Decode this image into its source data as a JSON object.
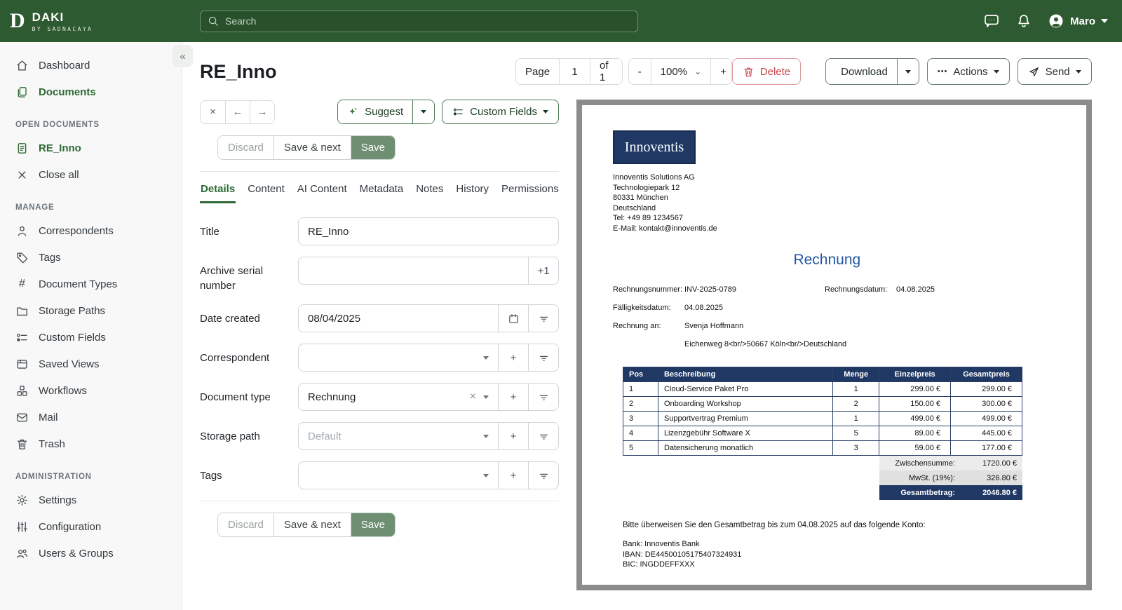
{
  "header": {
    "logo_initial": "D",
    "brand": "DAKI",
    "brand_sub": "BY SADNACAYA",
    "search_placeholder": "Search",
    "user_name": "Maro"
  },
  "sidebar": {
    "nav": [
      {
        "label": "Dashboard"
      },
      {
        "label": "Documents"
      }
    ],
    "sections": [
      {
        "title": "OPEN DOCUMENTS",
        "items": [
          {
            "label": "RE_Inno"
          },
          {
            "label": "Close all"
          }
        ]
      },
      {
        "title": "MANAGE",
        "items": [
          {
            "label": "Correspondents"
          },
          {
            "label": "Tags"
          },
          {
            "label": "Document Types"
          },
          {
            "label": "Storage Paths"
          },
          {
            "label": "Custom Fields"
          },
          {
            "label": "Saved Views"
          },
          {
            "label": "Workflows"
          },
          {
            "label": "Mail"
          },
          {
            "label": "Trash"
          }
        ]
      },
      {
        "title": "ADMINISTRATION",
        "items": [
          {
            "label": "Settings"
          },
          {
            "label": "Configuration"
          },
          {
            "label": "Users & Groups"
          }
        ]
      }
    ]
  },
  "toolbar": {
    "document_title": "RE_Inno",
    "page_label": "Page",
    "page_value": "1",
    "page_of": "of 1",
    "zoom_out": "-",
    "zoom_value": "100%",
    "zoom_in": "+",
    "delete": "Delete",
    "download": "Download",
    "actions": "Actions",
    "actions_dots": "•••",
    "send": "Send"
  },
  "editor": {
    "close": "×",
    "prev": "←",
    "next": "→",
    "collapse": "«",
    "suggest": "Suggest",
    "custom_fields": "Custom Fields",
    "discard": "Discard",
    "save_next": "Save & next",
    "save": "Save",
    "tabs": [
      "Details",
      "Content",
      "AI Content",
      "Metadata",
      "Notes",
      "History",
      "Permissions"
    ],
    "fields": {
      "title": {
        "label": "Title",
        "value": "RE_Inno"
      },
      "asn": {
        "label": "Archive serial number",
        "value": "",
        "increment": "+1"
      },
      "date_created": {
        "label": "Date created",
        "value": "08/04/2025"
      },
      "correspondent": {
        "label": "Correspondent",
        "value": ""
      },
      "document_type": {
        "label": "Document type",
        "value": "Rechnung",
        "clear": "×"
      },
      "storage_path": {
        "label": "Storage path",
        "placeholder": "Default"
      },
      "tags": {
        "label": "Tags",
        "value": ""
      }
    }
  },
  "invoice": {
    "logo_text": "Innoventis",
    "sender_lines": [
      "Innoventis Solutions AG",
      "Technologiepark 12",
      "80331 München",
      "Deutschland",
      "Tel: +49 89 1234567",
      "E-Mail: kontakt@innoventis.de"
    ],
    "title": "Rechnung",
    "meta": {
      "invoice_number_label": "Rechnungsnummer:",
      "invoice_number": "INV-2025-0789",
      "invoice_date_label": "Rechnungsdatum:",
      "invoice_date": "04.08.2025",
      "due_date_label": "Fälligkeitsdatum:",
      "due_date": "04.08.2025",
      "bill_to_label": "Rechnung an:",
      "bill_to_name": "Svenja Hoffmann",
      "bill_to_address": "Eichenweg 8<br/>50667 Köln<br/>Deutschland"
    },
    "table": {
      "headers": [
        "Pos",
        "Beschreibung",
        "Menge",
        "Einzelpreis",
        "Gesamtpreis"
      ],
      "rows": [
        [
          "1",
          "Cloud-Service Paket Pro",
          "1",
          "299.00 €",
          "299.00 €"
        ],
        [
          "2",
          "Onboarding Workshop",
          "2",
          "150.00 €",
          "300.00 €"
        ],
        [
          "3",
          "Supportvertrag Premium",
          "1",
          "499.00 €",
          "499.00 €"
        ],
        [
          "4",
          "Lizenzgebühr Software X",
          "5",
          "89.00 €",
          "445.00 €"
        ],
        [
          "5",
          "Datensicherung monatlich",
          "3",
          "59.00 €",
          "177.00 €"
        ]
      ]
    },
    "totals": [
      {
        "label": "Zwischensumme:",
        "value": "1720.00 €"
      },
      {
        "label": "MwSt. (19%):",
        "value": "326.80 €"
      },
      {
        "label": "Gesamtbetrag:",
        "value": "2046.80 €"
      }
    ],
    "payment_note": "Bitte überweisen Sie den Gesamtbetrag bis zum 04.08.2025 auf das folgende Konto:",
    "bank_lines": [
      "Bank: Innoventis Bank",
      "IBAN: DE44500105175407324931",
      "BIC: INGDDEFFXXX"
    ]
  },
  "colors": {
    "header_green": "#2d5a30",
    "accent_green": "#2e6934",
    "save_green": "#6e8f71",
    "delete_red": "#c2434c",
    "invoice_navy": "#1f3864",
    "invoice_blue": "#2456a4"
  }
}
